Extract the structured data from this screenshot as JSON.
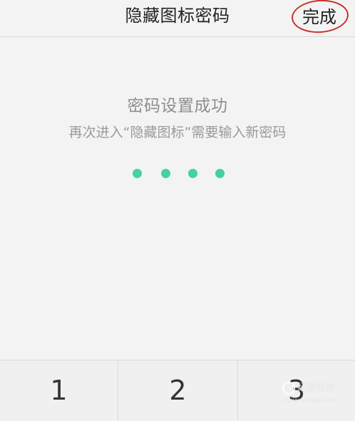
{
  "navigation": {
    "title": "隐藏图标密码",
    "done_label": "完成"
  },
  "status": {
    "title": "密码设置成功",
    "subtitle": "再次进入“隐藏图标”需要输入新密码"
  },
  "password_indicator": {
    "filled_count": 4,
    "total_count": 4,
    "color": "#44d29d"
  },
  "keypad": {
    "keys": [
      "1",
      "2",
      "3"
    ]
  },
  "watermark": {
    "logo": "S",
    "text": "经验指南",
    "domain": "shouyou.sogou.com"
  },
  "colors": {
    "background": "#f3f3f3",
    "text_primary": "#222222",
    "text_secondary": "#8d8d8d",
    "accent_green": "#44d29d",
    "annotation_red": "#c8322b"
  }
}
